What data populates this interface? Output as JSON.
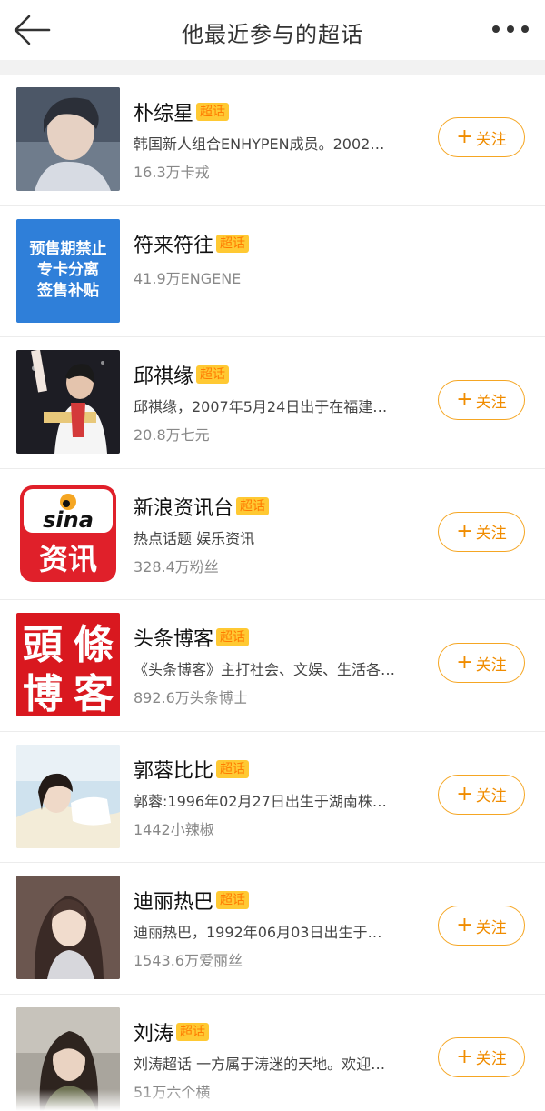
{
  "nav": {
    "title": "他最近参与的超话"
  },
  "items": [
    {
      "name": "朴综星",
      "tag": "超话",
      "desc": "韩国新人组合ENHYPEN成员。2002…",
      "fans": "16.3万卡戎",
      "follow": "关注",
      "follow_icon": "+"
    },
    {
      "name": "符来符往",
      "tag": "超话",
      "desc": "",
      "fans": "41.9万ENGENE",
      "follow": "",
      "follow_icon": "",
      "thumb_lines": [
        "预售期禁止",
        "专卡分离",
        "签售补贴"
      ]
    },
    {
      "name": "邱祺缘",
      "tag": "超话",
      "desc": "邱祺缘，2007年5月24日出于在福建…",
      "fans": "20.8万七元",
      "follow": "关注",
      "follow_icon": "+"
    },
    {
      "name": "新浪资讯台",
      "tag": "超话",
      "desc": "热点话题 娱乐资讯",
      "fans": "328.4万粉丝",
      "follow": "关注",
      "follow_icon": "+",
      "logo_top": "sina",
      "logo_bottom": "资讯"
    },
    {
      "name": "头条博客",
      "tag": "超话",
      "desc": "《头条博客》主打社会、文娱、生活各…",
      "fans": "892.6万头条博士",
      "follow": "关注",
      "follow_icon": "+",
      "logo_chars": [
        "頭",
        "條",
        "博",
        "客"
      ]
    },
    {
      "name": "郭蓉比比",
      "tag": "超话",
      "desc": "郭蓉:1996年02月27日出生于湖南株…",
      "fans": "1442小辣椒",
      "follow": "关注",
      "follow_icon": "+"
    },
    {
      "name": "迪丽热巴",
      "tag": "超话",
      "desc": "迪丽热巴，1992年06月03日出生于…",
      "fans": "1543.6万爱丽丝",
      "follow": "关注",
      "follow_icon": "+"
    },
    {
      "name": "刘涛",
      "tag": "超话",
      "desc": "刘涛超话 一方属于涛迷的天地。欢迎…",
      "fans": "51万六个横",
      "follow": "关注",
      "follow_icon": "+"
    }
  ]
}
